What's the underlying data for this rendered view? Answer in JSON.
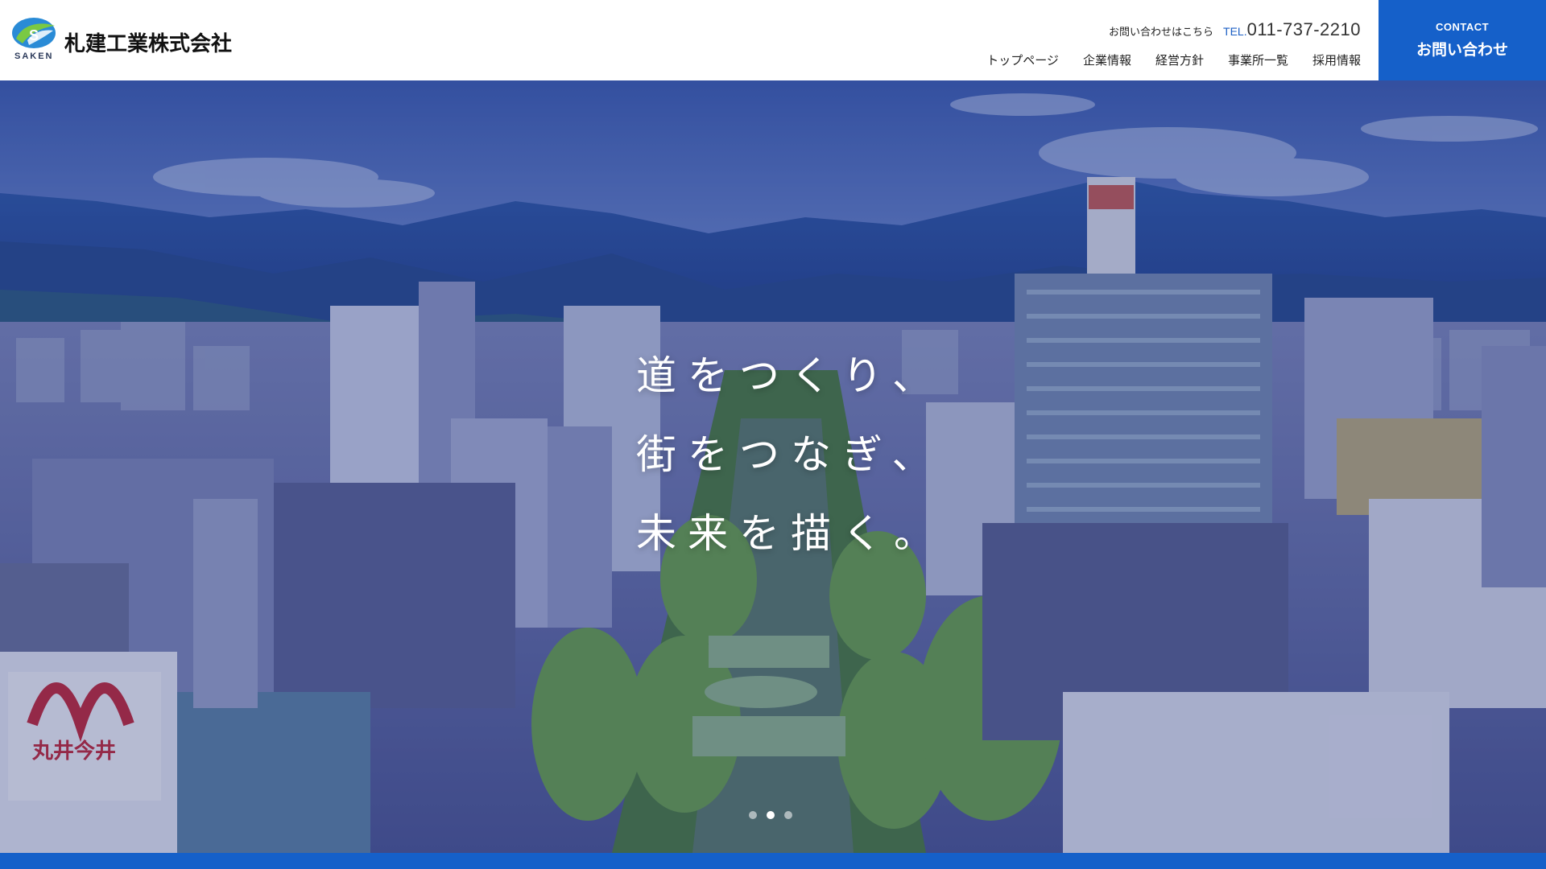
{
  "header": {
    "logo_icon": "saken-leaf-logo-icon",
    "logo_sub": "SAKEN",
    "company_name": "札建工業株式会社",
    "inquiry_label": "お問い合わせはこちら",
    "tel_prefix": "TEL.",
    "tel_number": "011-737-2210",
    "nav": [
      {
        "label": "トップページ"
      },
      {
        "label": "企業情報"
      },
      {
        "label": "経営方針"
      },
      {
        "label": "事業所一覧"
      },
      {
        "label": "採用情報"
      }
    ],
    "contact_en": "CONTACT",
    "contact_jp": "お問い合わせ"
  },
  "hero": {
    "catchcopy": [
      "道をつくり、",
      "街をつなぎ、",
      "未来を描く。"
    ],
    "slide_count": 3,
    "active_slide": 1
  },
  "colors": {
    "brand_blue": "#1560c9",
    "overlay": "#1e2d78"
  }
}
